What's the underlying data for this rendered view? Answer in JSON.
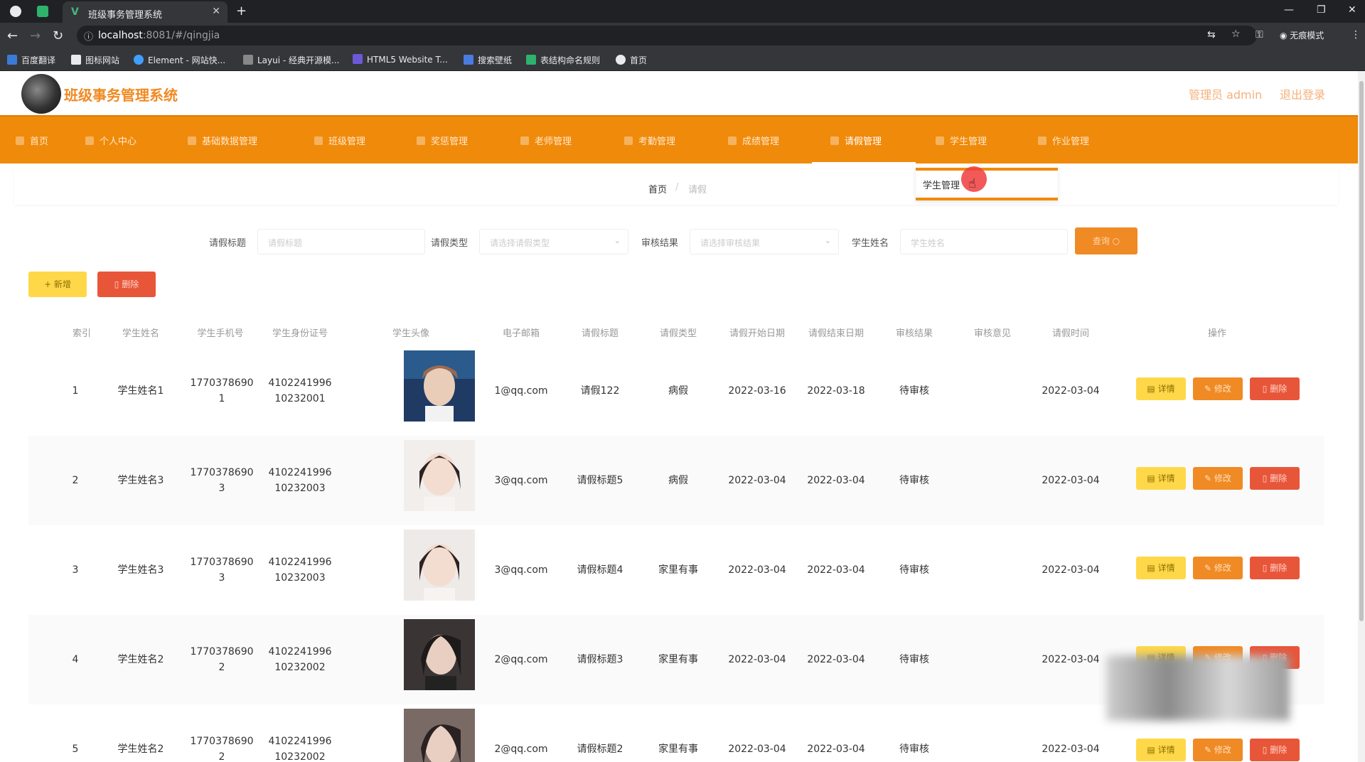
{
  "browser": {
    "tab_title": "班级事务管理系统",
    "url_host": "localhost",
    "url_rest": ":8081/#/qingjia",
    "incognito_label": "无痕模式",
    "bookmarks": [
      "百度翻译",
      "图标网站",
      "Element - 网站快...",
      "Layui - 经典开源模...",
      "HTML5 Website T...",
      "搜索壁纸",
      "表结构命名规则",
      "首页"
    ]
  },
  "header": {
    "title": "班级事务管理系统",
    "admin": "管理员 admin",
    "logout": "退出登录"
  },
  "nav": {
    "items": [
      "首页",
      "个人中心",
      "基础数据管理",
      "班级管理",
      "奖惩管理",
      "老师管理",
      "考勤管理",
      "成绩管理",
      "请假管理",
      "学生管理",
      "作业管理"
    ],
    "active": "请假管理",
    "dropdown_item": "学生管理"
  },
  "breadcrumb": {
    "home": "首页",
    "sep": "/",
    "current": "请假"
  },
  "search": {
    "title_label": "请假标题",
    "title_placeholder": "请假标题",
    "type_label": "请假类型",
    "type_placeholder": "请选择请假类型",
    "result_label": "审核结果",
    "result_placeholder": "请选择审核结果",
    "name_label": "学生姓名",
    "name_placeholder": "学生姓名",
    "button": "查询"
  },
  "actions": {
    "add": "+ 新增",
    "delete": "删除"
  },
  "table": {
    "columns": [
      "索引",
      "学生姓名",
      "学生手机号",
      "学生身份证号",
      "学生头像",
      "电子邮箱",
      "请假标题",
      "请假类型",
      "请假开始日期",
      "请假结束日期",
      "审核结果",
      "审核意见",
      "请假时间",
      "操作"
    ],
    "rows": [
      {
        "index": "1",
        "name": "学生姓名1",
        "phone1": "1770378690",
        "phone2": "1",
        "id1": "4102241996",
        "id2": "10232001",
        "email": "1@qq.com",
        "title": "请假122",
        "type": "病假",
        "start": "2022-03-16",
        "end": "2022-03-18",
        "result": "待审核",
        "opinion": "",
        "time": "2022-03-04"
      },
      {
        "index": "2",
        "name": "学生姓名3",
        "phone1": "1770378690",
        "phone2": "3",
        "id1": "4102241996",
        "id2": "10232003",
        "email": "3@qq.com",
        "title": "请假标题5",
        "type": "病假",
        "start": "2022-03-04",
        "end": "2022-03-04",
        "result": "待审核",
        "opinion": "",
        "time": "2022-03-04"
      },
      {
        "index": "3",
        "name": "学生姓名3",
        "phone1": "1770378690",
        "phone2": "3",
        "id1": "4102241996",
        "id2": "10232003",
        "email": "3@qq.com",
        "title": "请假标题4",
        "type": "家里有事",
        "start": "2022-03-04",
        "end": "2022-03-04",
        "result": "待审核",
        "opinion": "",
        "time": "2022-03-04"
      },
      {
        "index": "4",
        "name": "学生姓名2",
        "phone1": "1770378690",
        "phone2": "2",
        "id1": "4102241996",
        "id2": "10232002",
        "email": "2@qq.com",
        "title": "请假标题3",
        "type": "家里有事",
        "start": "2022-03-04",
        "end": "2022-03-04",
        "result": "待审核",
        "opinion": "",
        "time": "2022-03-04"
      },
      {
        "index": "5",
        "name": "学生姓名2",
        "phone1": "1770378690",
        "phone2": "2",
        "id1": "4102241996",
        "id2": "10232002",
        "email": "2@qq.com",
        "title": "请假标题2",
        "type": "家里有事",
        "start": "2022-03-04",
        "end": "2022-03-04",
        "result": "待审核",
        "opinion": "",
        "time": "2022-03-04"
      }
    ],
    "row_buttons": {
      "detail": "详情",
      "edit": "修改",
      "remove": "删除"
    }
  },
  "colors": {
    "primary": "#f08a0a",
    "accent": "#f08a24",
    "yellow": "#ffd84a",
    "danger": "#e8563a"
  }
}
